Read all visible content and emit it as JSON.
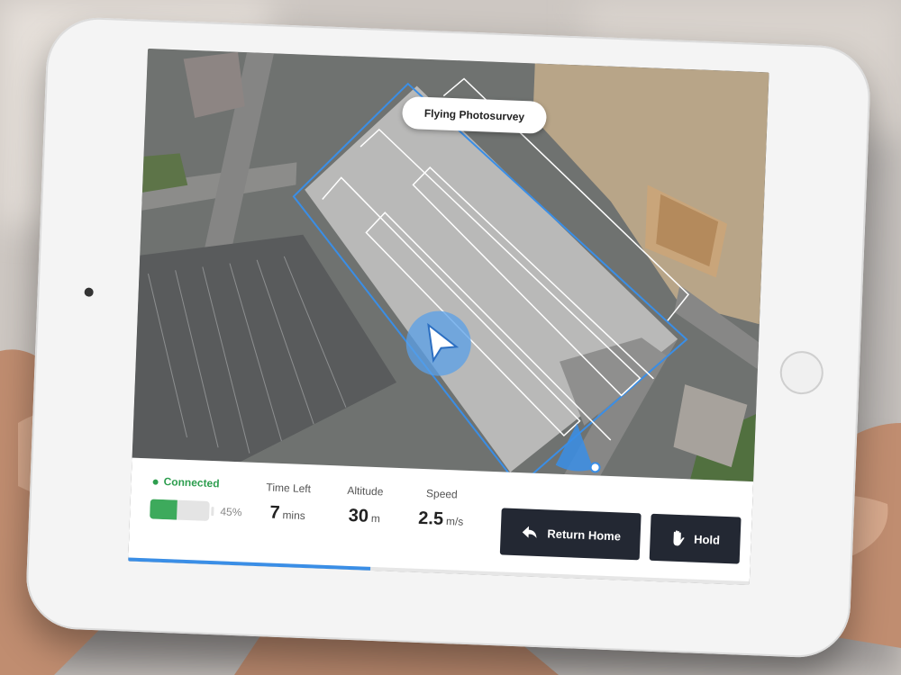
{
  "screen": {
    "flight_status": "Flying Photosurvey"
  },
  "status": {
    "connection": "Connected",
    "battery_percent": 45,
    "battery_label": "45%"
  },
  "stats": {
    "time_left": {
      "label": "Time Left",
      "value": "7",
      "unit": "mins"
    },
    "altitude": {
      "label": "Altitude",
      "value": "30",
      "unit": "m"
    },
    "speed": {
      "label": "Speed",
      "value": "2.5",
      "unit": "m/s"
    }
  },
  "actions": {
    "return_home": "Return Home",
    "hold": "Hold"
  },
  "mission_progress_fraction": 0.39,
  "colors": {
    "accent": "#3a8ee6",
    "connected": "#2e9e4f",
    "battery": "#3daa5c",
    "button_bg": "#232833"
  }
}
